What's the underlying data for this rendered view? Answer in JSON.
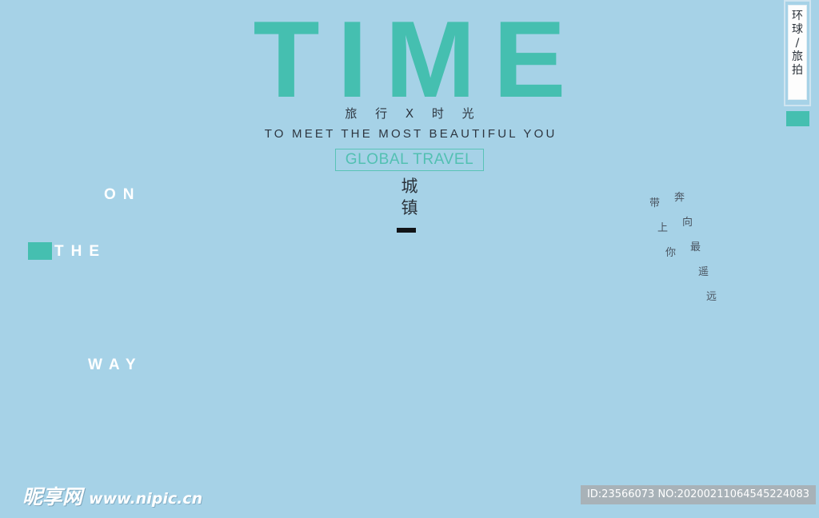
{
  "poster": {
    "background_color": "#a6d2e7",
    "accent_color": "#45bfb0",
    "dark_text_color": "#2e3640"
  },
  "headline": {
    "title": "TIME"
  },
  "subtitle": {
    "chinese": "旅 行 X 时 光",
    "english": "TO MEET THE MOST BEAUTIFUL YOU",
    "boxed_label": "GLOBAL TRAVEL"
  },
  "center": {
    "line1": "城",
    "line2": "镇"
  },
  "left_words": {
    "on": "ON",
    "the": "THE",
    "way": "WAY"
  },
  "right_vertical": {
    "column_a": [
      "带",
      "上",
      "你"
    ],
    "column_b": [
      "奔",
      "向",
      "最",
      "遥",
      "远"
    ]
  },
  "badge": {
    "chars": [
      "环",
      "球",
      "/",
      "旅",
      "拍"
    ]
  },
  "watermark": {
    "site_name": "昵享网",
    "url": "www.nipic.cn"
  },
  "footer": {
    "id_text": "ID:23566073 NO:20200211064545224083"
  }
}
